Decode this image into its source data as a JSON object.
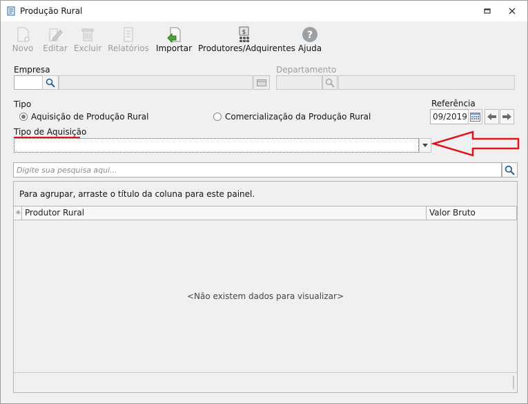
{
  "window": {
    "title": "Produção Rural"
  },
  "toolbar": {
    "novo": "Novo",
    "editar": "Editar",
    "excluir": "Excluir",
    "relatorios": "Relatórios",
    "importar": "Importar",
    "produtores": "Produtores/Adquirentes",
    "ajuda": "Ajuda"
  },
  "form": {
    "empresa_label": "Empresa",
    "empresa_code": "",
    "empresa_name": "",
    "departamento_label": "Departamento",
    "departamento_code": "",
    "departamento_name": "",
    "tipo_label": "Tipo",
    "tipo_options": [
      "Aquisição de Produção Rural",
      "Comercialização da Produção Rural"
    ],
    "tipo_selected": "Aquisição de Produção Rural",
    "referencia_label": "Referência",
    "referencia_value": "09/2019",
    "tipo_aquisicao_label": "Tipo de Aquisição",
    "tipo_aquisicao_value": ""
  },
  "search": {
    "placeholder": "Digite sua pesquisa aqui..."
  },
  "grid": {
    "group_hint": "Para agrupar, arraste o título da coluna para este painel.",
    "columns": [
      "Produtor Rural",
      "Valor Bruto"
    ],
    "empty_text": "<Não existem dados para visualizar>"
  },
  "colors": {
    "arrow": "#e0131b",
    "underline": "#e0131b"
  }
}
